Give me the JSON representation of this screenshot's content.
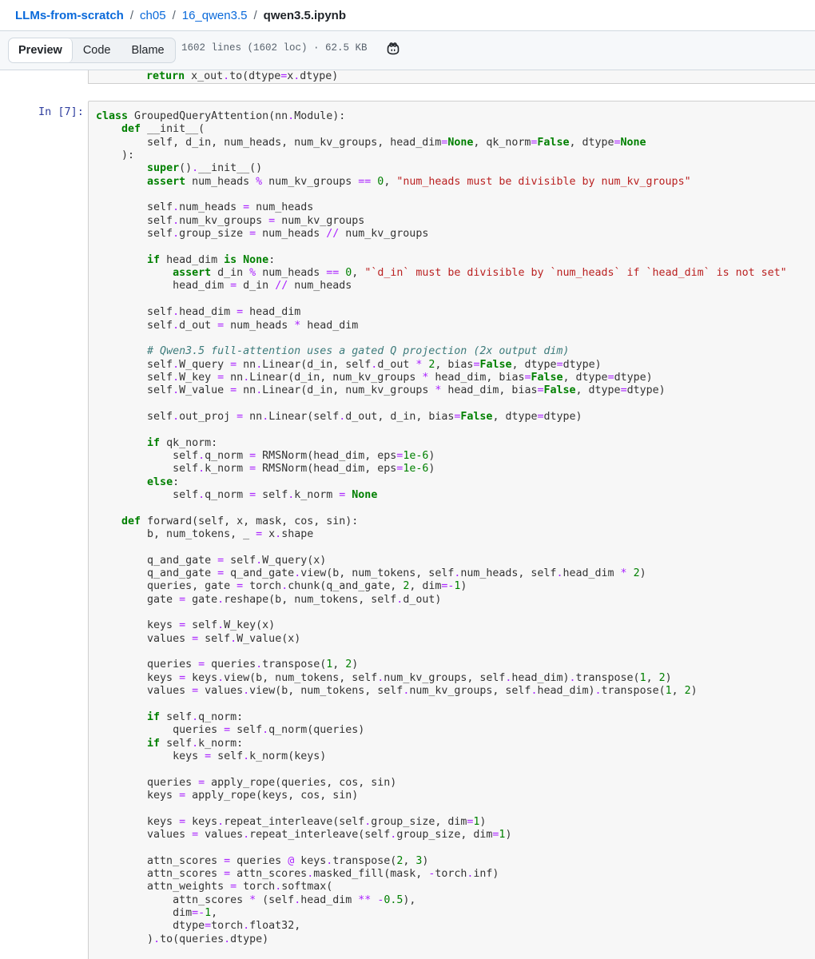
{
  "breadcrumb": {
    "repo": "LLMs-from-scratch",
    "sep": "/",
    "dir1": "ch05",
    "dir2": "16_qwen3.5",
    "file": "qwen3.5.ipynb"
  },
  "toolbar": {
    "tabs": [
      "Preview",
      "Code",
      "Blame"
    ],
    "active_tab": "Preview",
    "file_info": "1602 lines (1602 loc) · 62.5 KB",
    "copilot_icon": "copilot-icon"
  },
  "notebook": {
    "prev_cell_tail": "return x_out.to(dtype=x.dtype)",
    "cell_prompt": "In [7]:"
  },
  "colors": {
    "link": "#0969da",
    "keyword": "#008000",
    "operator": "#aa22ff",
    "string": "#ba2121",
    "comment": "#3d7b7b",
    "prompt": "#303f9f"
  }
}
